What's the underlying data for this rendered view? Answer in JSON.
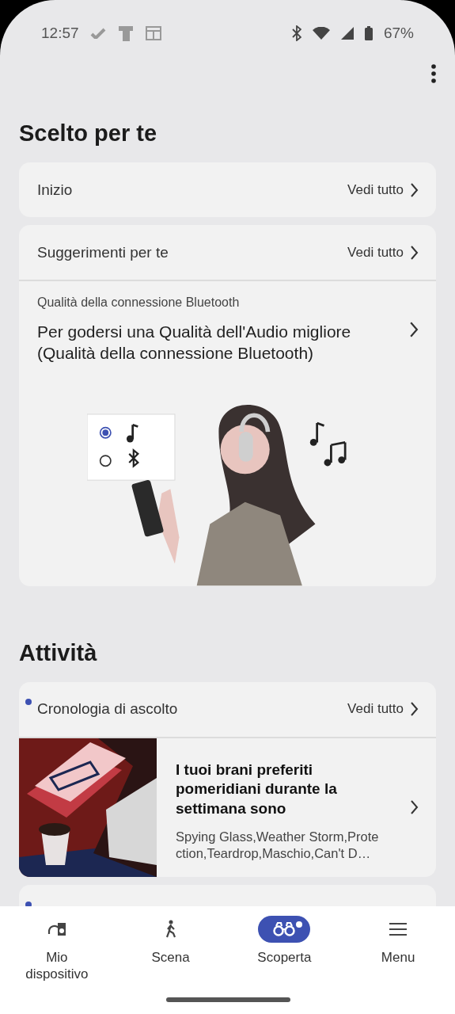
{
  "status_bar": {
    "time": "12:57",
    "battery": "67%"
  },
  "sections": [
    {
      "title": "Scelto per te",
      "cards": [
        {
          "kind": "link",
          "label": "Inizio",
          "action": "Vedi tutto",
          "unread": false
        },
        {
          "kind": "feature",
          "label": "Suggerimenti per te",
          "action": "Vedi tutto",
          "unread": false,
          "eyebrow": "Qualità della connessione Bluetooth",
          "headline": "Per godersi una Qualità dell'Audio migliore (Qualità della connessione Bluetooth)"
        }
      ]
    },
    {
      "title": "Attività",
      "cards": [
        {
          "kind": "history",
          "label": "Cronologia di ascolto",
          "action": "Vedi tutto",
          "unread": true,
          "headline": "I tuoi brani preferiti pomeridiani durante la settimana sono",
          "detail": "Spying Glass,Weather Storm,Protection,Teardrop,Maschio,Can't D…"
        },
        {
          "kind": "peek",
          "unread": true
        }
      ]
    }
  ],
  "nav": [
    {
      "label": "Mio dispositivo",
      "kind": "device",
      "selected": false,
      "badge": false
    },
    {
      "label": "Scena",
      "kind": "walk",
      "selected": false,
      "badge": false
    },
    {
      "label": "Scoperta",
      "kind": "discover",
      "selected": true,
      "badge": true
    },
    {
      "label": "Menu",
      "kind": "menu",
      "selected": false,
      "badge": false
    }
  ]
}
